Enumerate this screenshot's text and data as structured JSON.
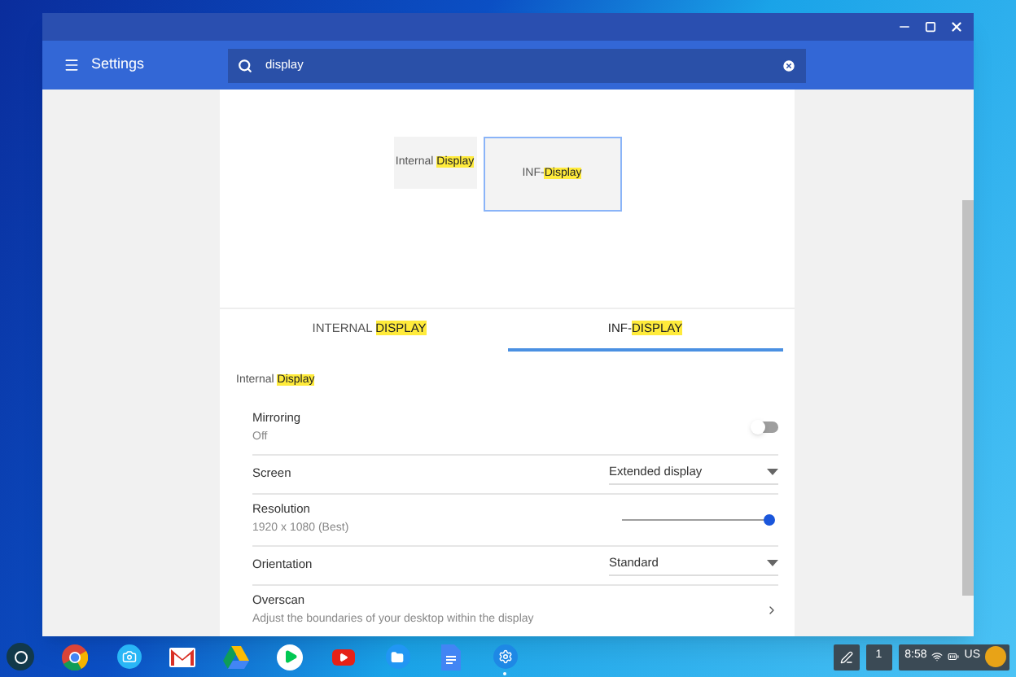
{
  "header": {
    "title": "Settings",
    "search": {
      "value": "display"
    }
  },
  "arrangement": [
    {
      "label": [
        {
          "text": "Internal ",
          "highlighted": false
        },
        {
          "text": "Display",
          "highlighted": true
        }
      ],
      "selected": false
    },
    {
      "label": [
        {
          "text": "INF-",
          "highlighted": false
        },
        {
          "text": "Display",
          "highlighted": true
        }
      ],
      "selected": true
    }
  ],
  "tabs": [
    {
      "label": [
        {
          "text": "INTERNAL ",
          "highlighted": false
        },
        {
          "text": "DISPLAY",
          "highlighted": true
        }
      ],
      "selected": false
    },
    {
      "label": [
        {
          "text": "INF-",
          "highlighted": false
        },
        {
          "text": "DISPLAY",
          "highlighted": true
        }
      ],
      "selected": true
    }
  ],
  "section_title": [
    {
      "text": "Internal ",
      "highlighted": false
    },
    {
      "text": "Display",
      "highlighted": true
    }
  ],
  "settings": [
    {
      "kind": "toggle",
      "label": "Mirroring",
      "sublabel": "Off",
      "on": false
    },
    {
      "kind": "select",
      "label": "Screen",
      "value": "Extended display"
    },
    {
      "kind": "slider",
      "label": "Resolution",
      "sublabel": "1920 x 1080 (Best)",
      "level": 1
    },
    {
      "kind": "select",
      "label": "Orientation",
      "value": "Standard"
    },
    {
      "kind": "link",
      "label": "Overscan",
      "sublabel": "Adjust the boundaries of your desktop within the display"
    }
  ],
  "shelf": {
    "apps": [
      {
        "kind": "chrome",
        "active": false
      },
      {
        "kind": "camera",
        "active": false
      },
      {
        "kind": "mail",
        "active": false
      },
      {
        "kind": "drive",
        "active": false
      },
      {
        "kind": "play",
        "active": false
      },
      {
        "kind": "video",
        "active": false
      },
      {
        "kind": "files",
        "active": false
      },
      {
        "kind": "docs",
        "active": false
      },
      {
        "kind": "settings",
        "active": true
      }
    ],
    "notification_count": "1",
    "time": "8:58",
    "locale": "US"
  }
}
